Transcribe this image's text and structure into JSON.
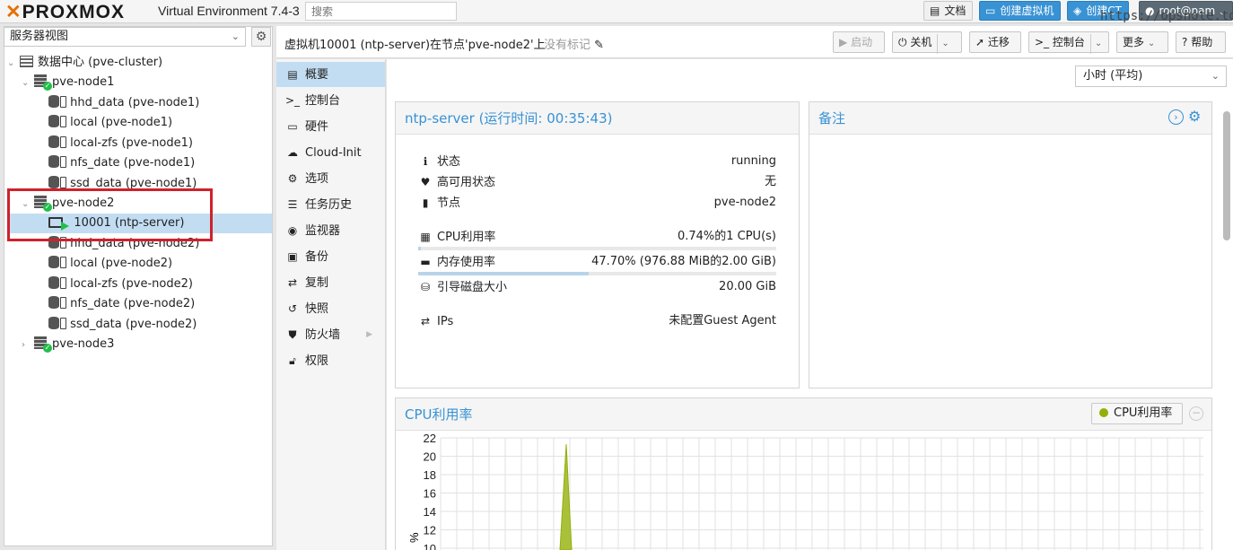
{
  "topbar": {
    "logo": "PROXMOX",
    "version": "Virtual Environment 7.4-3",
    "search_placeholder": "搜索",
    "docs_label": "文档",
    "create_vm_label": "创建虚拟机",
    "create_ct_label": "创建CT",
    "user_label": "root@pam",
    "watermark": "https://opsnote.top"
  },
  "sidebar": {
    "view_label": "服务器视图",
    "tree": [
      {
        "label": "数据中心 (pve-cluster)",
        "type": "datacenter"
      },
      {
        "label": "pve-node1",
        "type": "node"
      },
      {
        "label": "hhd_data (pve-node1)",
        "type": "storage"
      },
      {
        "label": "local (pve-node1)",
        "type": "storage"
      },
      {
        "label": "local-zfs (pve-node1)",
        "type": "storage"
      },
      {
        "label": "nfs_date (pve-node1)",
        "type": "storage"
      },
      {
        "label": "ssd_data (pve-node1)",
        "type": "storage"
      },
      {
        "label": "pve-node2",
        "type": "node"
      },
      {
        "label": "10001 (ntp-server)",
        "type": "vm",
        "selected": true
      },
      {
        "label": "hhd_data (pve-node2)",
        "type": "storage"
      },
      {
        "label": "local (pve-node2)",
        "type": "storage"
      },
      {
        "label": "local-zfs (pve-node2)",
        "type": "storage"
      },
      {
        "label": "nfs_date (pve-node2)",
        "type": "storage"
      },
      {
        "label": "ssd_data (pve-node2)",
        "type": "storage"
      },
      {
        "label": "pve-node3",
        "type": "node"
      }
    ]
  },
  "header": {
    "title": "虚拟机10001 (ntp-server)在节点'pve-node2'上",
    "no_tags": "没有标记",
    "start_label": "启动",
    "shutdown_label": "关机",
    "migrate_label": "迁移",
    "console_label": "控制台",
    "more_label": "更多",
    "help_label": "帮助"
  },
  "submenu": {
    "items": [
      {
        "label": "概要",
        "icon": "book-icon"
      },
      {
        "label": "控制台",
        "icon": "terminal-icon"
      },
      {
        "label": "硬件",
        "icon": "monitor-icon"
      },
      {
        "label": "Cloud-Init",
        "icon": "cloud-icon"
      },
      {
        "label": "选项",
        "icon": "gear-icon"
      },
      {
        "label": "任务历史",
        "icon": "list-icon"
      },
      {
        "label": "监视器",
        "icon": "eye-icon"
      },
      {
        "label": "备份",
        "icon": "floppy-icon"
      },
      {
        "label": "复制",
        "icon": "retweet-icon"
      },
      {
        "label": "快照",
        "icon": "history-icon"
      },
      {
        "label": "防火墙",
        "icon": "shield-icon"
      },
      {
        "label": "权限",
        "icon": "unlock-icon"
      }
    ]
  },
  "timeframe": "小时 (平均)",
  "status_panel": {
    "title": "ntp-server (运行时间: 00:35:43)",
    "rows": {
      "status_label": "状态",
      "status_value": "running",
      "ha_label": "高可用状态",
      "ha_value": "无",
      "node_label": "节点",
      "node_value": "pve-node2",
      "cpu_label": "CPU利用率",
      "cpu_value": "0.74%的1 CPU(s)",
      "mem_label": "内存使用率",
      "mem_value": "47.70% (976.88 MiB的2.00 GiB)",
      "disk_label": "引导磁盘大小",
      "disk_value": "20.00 GiB",
      "ips_label": "IPs",
      "ips_value": "未配置Guest Agent"
    },
    "cpu_fraction": 0.0074,
    "mem_fraction": 0.477
  },
  "notes_panel": {
    "title": "备注"
  },
  "cpu_chart": {
    "title": "CPU利用率",
    "legend_label": "CPU利用率"
  },
  "chart_data": {
    "type": "area",
    "title": "CPU利用率",
    "ylabel": "%",
    "yticks": [
      22,
      20,
      18,
      16,
      14,
      12,
      10
    ],
    "ylim": [
      10,
      22
    ],
    "series": [
      {
        "name": "CPU利用率",
        "color": "#94ae0a",
        "peak": 21.3
      }
    ]
  }
}
